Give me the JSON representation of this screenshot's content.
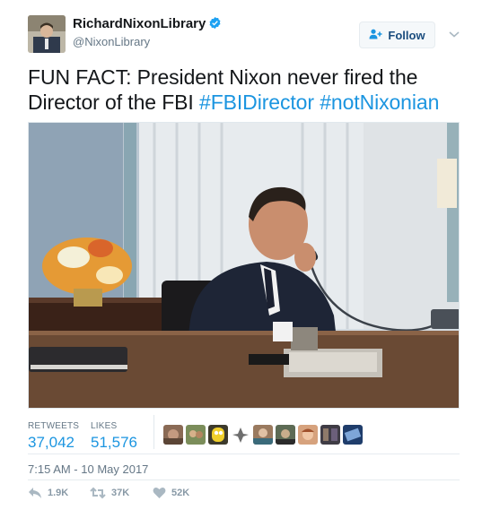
{
  "user": {
    "display_name": "RichardNixonLibrary",
    "handle": "@NixonLibrary",
    "verified": true
  },
  "follow_button": {
    "label": "Follow"
  },
  "tweet": {
    "text_plain": "FUN FACT: President Nixon never fired the Director of the FBI ",
    "hashtags": [
      "#FBIDirector",
      "#notNixonian"
    ],
    "timestamp": "7:15 AM - 10 May 2017"
  },
  "stats": {
    "retweets_label": "RETWEETS",
    "retweets_value": "37,042",
    "likes_label": "LIKES",
    "likes_value": "51,576"
  },
  "actions": {
    "reply_count": "1.9K",
    "retweet_count": "37K",
    "like_count": "52K"
  },
  "icons": {
    "verified": "verified-badge-icon",
    "follow": "add-user-icon",
    "more": "chevron-down-icon",
    "reply": "reply-icon",
    "retweet": "retweet-icon",
    "like": "heart-icon"
  },
  "colors": {
    "link": "#1b95e0",
    "muted": "#657786",
    "text": "#14171a",
    "verified": "#1da1f2"
  }
}
